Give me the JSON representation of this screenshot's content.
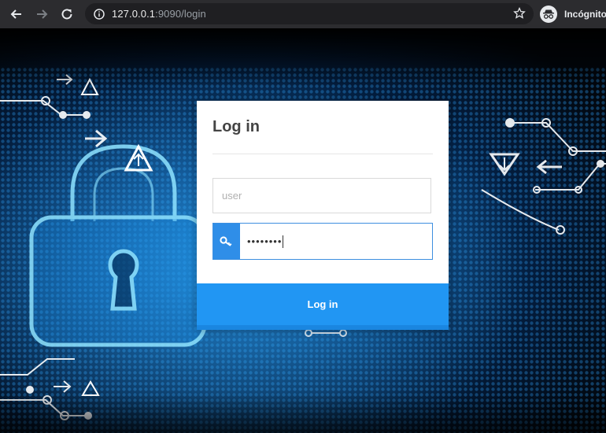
{
  "browser": {
    "url_host": "127.0.0.1",
    "url_rest": ":9090/login",
    "profile_label": "Incógnito",
    "icons": {
      "back": "back-arrow-icon",
      "forward": "forward-arrow-icon",
      "reload": "reload-icon",
      "site_info": "info-icon",
      "bookmark": "star-icon",
      "profile": "incognito-icon"
    }
  },
  "login": {
    "title": "Log in",
    "username_placeholder": "user",
    "username_value": "",
    "password_masked": "••••••••",
    "submit_label": "Log in",
    "password_icon": "key-icon"
  },
  "colors": {
    "accent": "#2196f3",
    "background_glow": "#0b5aa6"
  }
}
